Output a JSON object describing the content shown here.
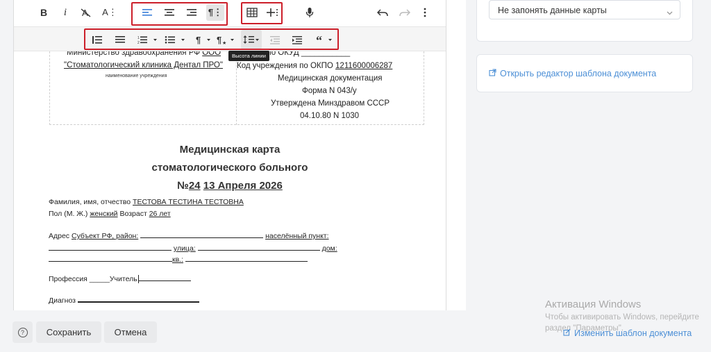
{
  "toolbar": {
    "bold": "B",
    "italic": "i",
    "font_size": "A⋮",
    "paragraph": "¶⋮",
    "tooltip": "Высота линии",
    "quote": "❝"
  },
  "document": {
    "ministry_prefix": "Министерство здравоохранения РФ",
    "ministry_value": "ООО",
    "clinic": "\"Стоматологический клиника Дентал ПРО\"",
    "clinic_caption": "наименование учреждения",
    "okud": "ы по ОКУД ___________",
    "okpo_label": "Код учреждения по ОКПО",
    "okpo_value": "1211600006287",
    "med_docs": "Медицинская документация",
    "form": "Форма N 043/у",
    "approved": "Утверждена Минздравом СССР",
    "approved_date": "04.10.80 N 1030",
    "title_line1": "Медицинская карта",
    "title_line2": "стоматологического больного",
    "title_no": "№",
    "title_number": "24",
    "title_date": "13 Апреля 2026",
    "fio_label": "Фамилия, имя, отчество",
    "fio_value": "ТЕСТОВА ТЕСТИНА ТЕСТОВНА",
    "gender_label": "Пол (М. Ж.)",
    "gender_value": "женский",
    "age_label": "Возраст",
    "age_value": "26 лет",
    "address_label": "Адрес",
    "address_region": "Субъект РФ, район:",
    "settlement": "населённый пункт:",
    "street": "улица:",
    "house": "дом:",
    "apt": "кв.:",
    "profession_label": "Профессия",
    "profession_value": "_____Учитель",
    "diagnosis_label": "Диагноз"
  },
  "sidebar": {
    "card_select": "Не запонять данные карты",
    "open_template_link": "Открыть редактор шаблона документа",
    "change_template_link": "Изменить шаблон документа"
  },
  "actions": {
    "help": "?",
    "save": "Сохранить",
    "cancel": "Отмена"
  },
  "watermark": {
    "title": "Активация Windows",
    "line1": "Чтобы активировать Windows, перейдите",
    "line2": "раздел \"Параметры\"."
  },
  "colors": {
    "highlight": "#cc1f2a",
    "accent": "#4c8fd6",
    "align_active": "#3b7fd9"
  }
}
